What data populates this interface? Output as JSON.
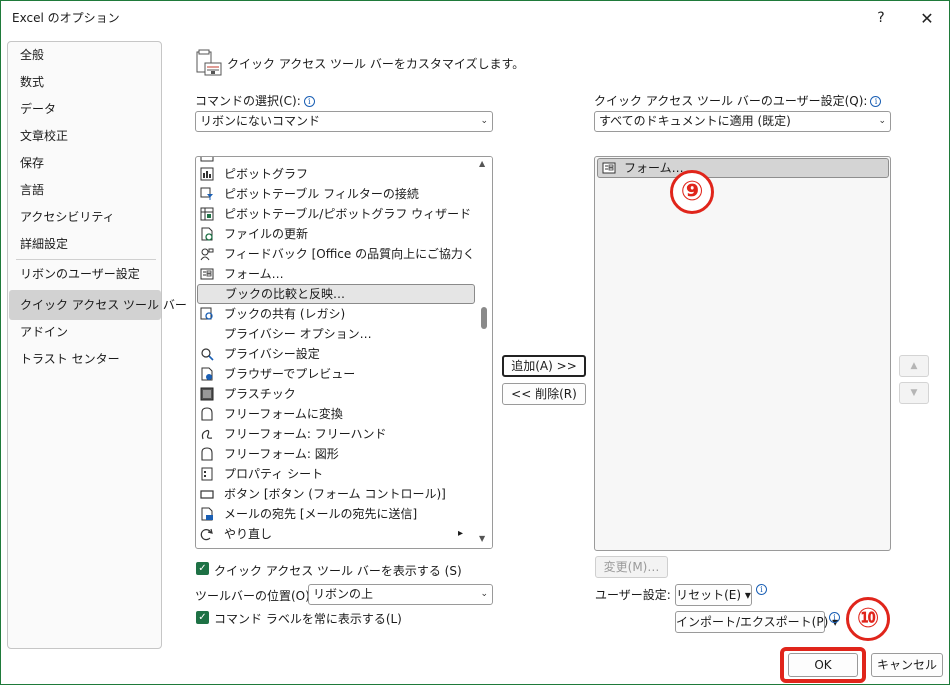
{
  "window": {
    "title": "Excel のオプション",
    "help": "?",
    "close": "✕"
  },
  "sidebar": {
    "items": [
      {
        "label": "全般"
      },
      {
        "label": "数式"
      },
      {
        "label": "データ"
      },
      {
        "label": "文章校正"
      },
      {
        "label": "保存"
      },
      {
        "label": "言語"
      },
      {
        "label": "アクセシビリティ"
      },
      {
        "label": "詳細設定"
      },
      {
        "label": "リボンのユーザー設定"
      },
      {
        "label": "クイック アクセス ツール バー",
        "selected": true
      },
      {
        "label": "アドイン"
      },
      {
        "label": "トラスト センター"
      }
    ]
  },
  "header": {
    "text": "クイック アクセス ツール バーをカスタマイズします。"
  },
  "left": {
    "commands_label": "コマンドの選択(C):",
    "commands_value": "リボンにないコマンド",
    "list": [
      {
        "label": "ピボットグラフ",
        "icon": "pivot-chart-icon"
      },
      {
        "label": "ピボットテーブル フィルターの接続",
        "icon": "pivot-filter-icon"
      },
      {
        "label": "ピボットテーブル/ピボットグラフ ウィザード",
        "icon": "pivot-wizard-icon"
      },
      {
        "label": "ファイルの更新",
        "icon": "refresh-file-icon"
      },
      {
        "label": "フィードバック [Office の品質向上にご協力く…",
        "icon": "feedback-icon"
      },
      {
        "label": "フォーム…",
        "icon": "form-icon"
      },
      {
        "label": "ブックの比較と反映…",
        "icon": "",
        "selected": true
      },
      {
        "label": "ブックの共有 (レガシ)",
        "icon": "share-workbook-icon"
      },
      {
        "label": "プライバシー オプション…",
        "icon": ""
      },
      {
        "label": "プライバシー設定",
        "icon": "privacy-settings-icon"
      },
      {
        "label": "ブラウザーでプレビュー",
        "icon": "browser-preview-icon"
      },
      {
        "label": "プラスチック",
        "icon": "plastic-icon"
      },
      {
        "label": "フリーフォームに変換",
        "icon": "freeform-convert-icon"
      },
      {
        "label": "フリーフォーム: フリーハンド",
        "icon": "freehand-icon"
      },
      {
        "label": "フリーフォーム: 図形",
        "icon": "freeform-shape-icon"
      },
      {
        "label": "プロパティ シート",
        "icon": "property-sheet-icon"
      },
      {
        "label": "ボタン [ボタン (フォーム コントロール)]",
        "icon": "button-control-icon"
      },
      {
        "label": "メールの宛先 [メールの宛先に送信]",
        "icon": "mail-recipient-icon"
      },
      {
        "label": "やり直し",
        "icon": "redo-icon",
        "submenu": "▸"
      }
    ],
    "show_qat_label": "クイック アクセス ツール バーを表示する (S)",
    "toolbar_pos_label": "ツールバーの位置(O)",
    "toolbar_pos_value": "リボンの上",
    "always_show_labels": "コマンド ラベルを常に表示する(L)"
  },
  "middle": {
    "add": "追加(A) >>",
    "remove": "<< 削除(R)"
  },
  "right": {
    "qat_label": "クイック アクセス ツール バーのユーザー設定(Q):",
    "qat_value": "すべてのドキュメントに適用 (既定)",
    "list": [
      {
        "label": "フォーム…",
        "icon": "form-icon"
      }
    ],
    "modify": "変更(M)…",
    "user_settings_label": "ユーザー設定:",
    "reset": "リセット(E) ▾",
    "import_export": "インポート/エクスポート(P) ▾"
  },
  "footer": {
    "ok": "OK",
    "cancel": "キャンセル"
  },
  "annotations": {
    "step9": "⑨",
    "step10": "⑩"
  },
  "colors": {
    "accent_green": "#1e7145",
    "annotation_red": "#e0251b"
  }
}
